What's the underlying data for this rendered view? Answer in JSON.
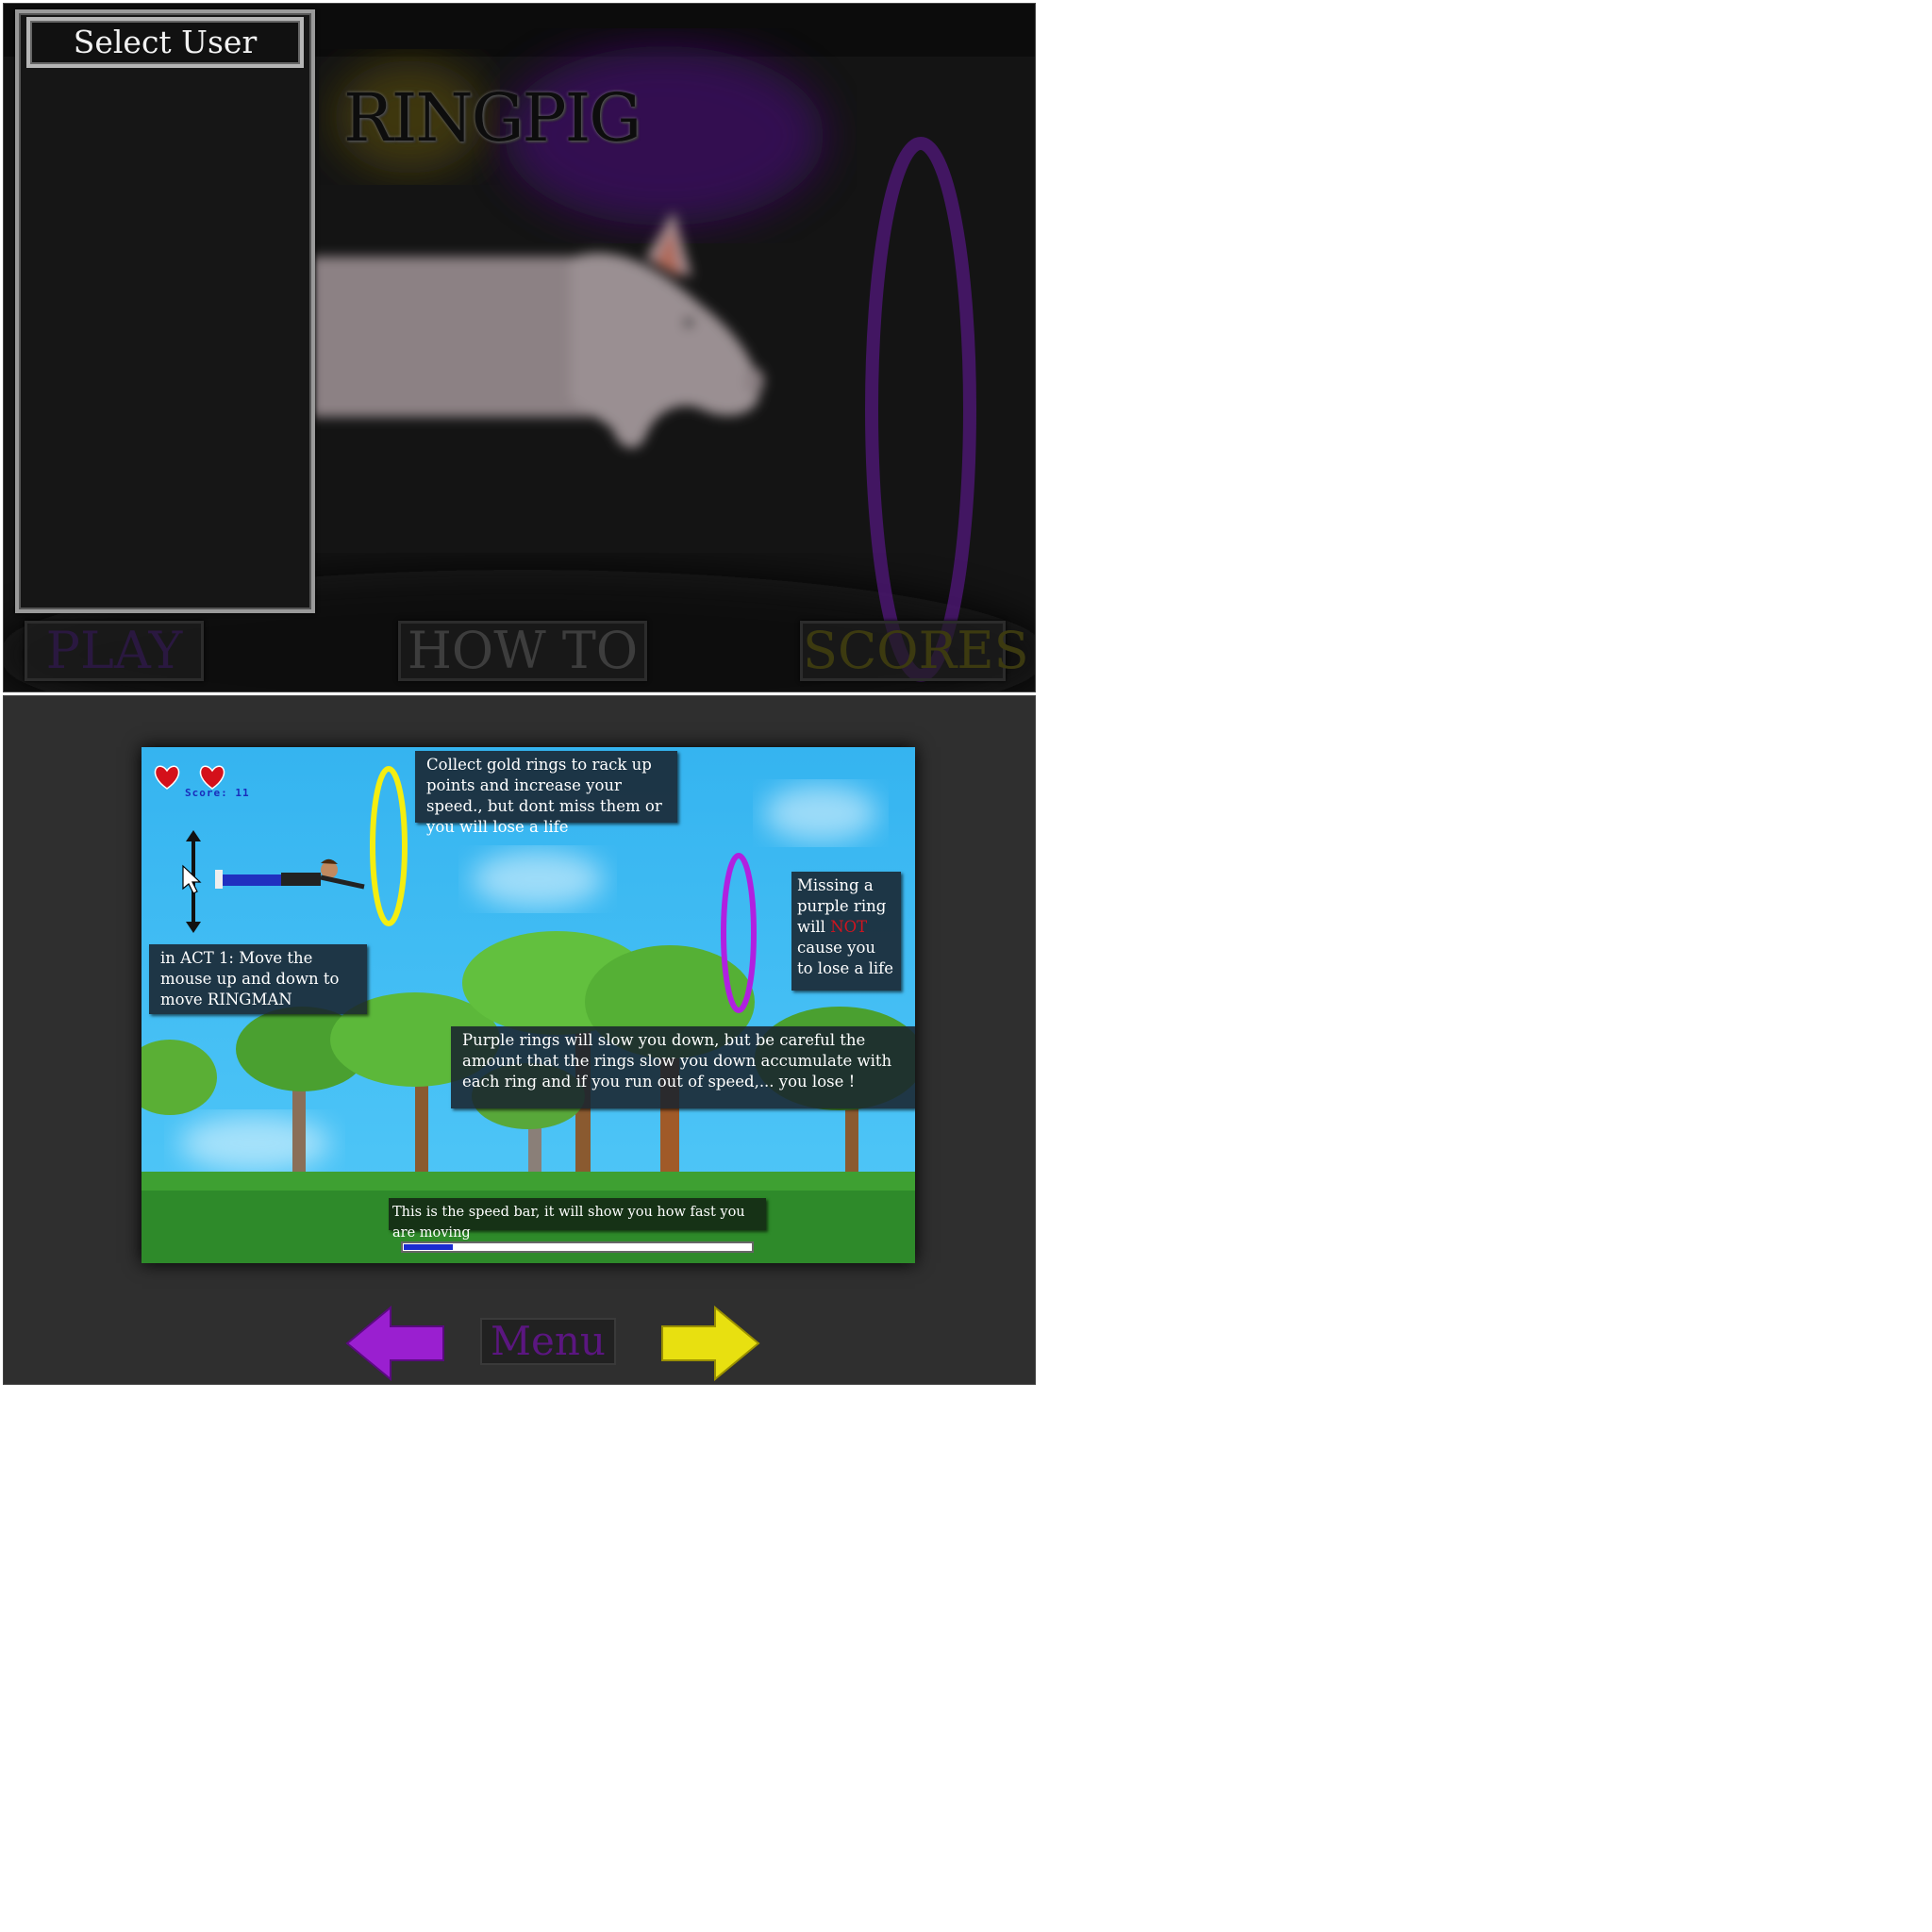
{
  "menu": {
    "user_panel_title": "Select User",
    "users": [],
    "game_title": "RINGPIG",
    "buttons": {
      "play": "PLAY",
      "how_to": "HOW TO",
      "scores": "SCORES"
    }
  },
  "howto": {
    "lives": 2,
    "score_text": "Score: 11",
    "tips": {
      "gold": "Collect gold rings to rack up points and increase your speed., but dont miss them or you will lose a life",
      "missing_purple_before": "Missing a purple ring will",
      "missing_purple_warn": "NOT",
      "missing_purple_after": "cause you to lose a life",
      "move": "in ACT 1: Move the mouse up and down to move RINGMAN",
      "purple": "Purple rings will slow you down, but be careful the amount that the rings slow you down accumulate with each ring and if you run out of speed,... you lose !",
      "speed": "This is the speed bar, it will show you how fast you are moving"
    },
    "speed_fraction": 0.14,
    "menu_button": "Menu"
  },
  "colors": {
    "gold_ring": "#f4ee10",
    "purple_ring": "#b020e0",
    "prev_arrow": "#9a1fd0",
    "next_arrow": "#e8e010",
    "warn": "#d0141f"
  },
  "icons": {
    "lives": "heart-icon",
    "prev": "left-arrow-icon",
    "next": "right-arrow-icon",
    "move": "vertical-double-arrow-icon",
    "cursor": "mouse-cursor-icon"
  }
}
